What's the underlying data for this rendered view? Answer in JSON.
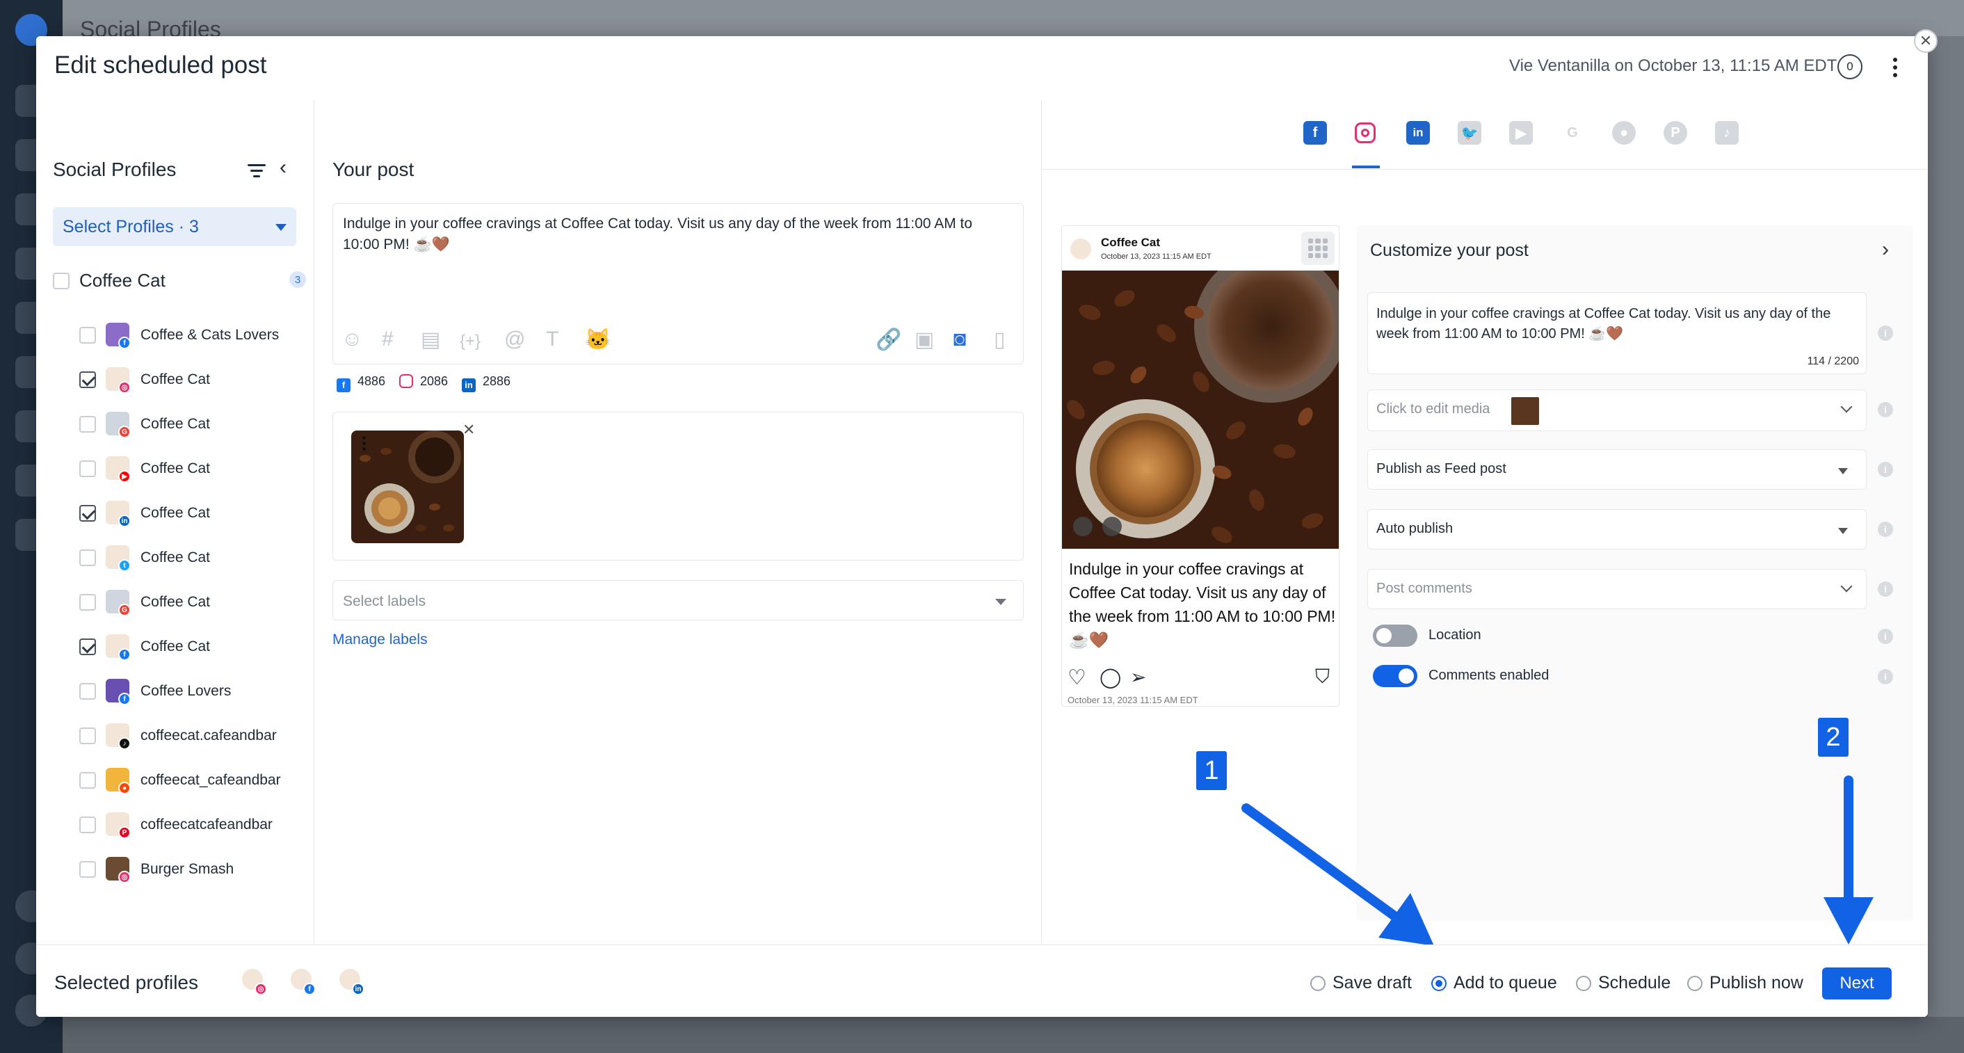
{
  "background": {
    "title": "Social Profiles"
  },
  "modal": {
    "title": "Edit scheduled post",
    "meta": "Vie Ventanilla on October 13, 11:15 AM EDT",
    "counter": "0"
  },
  "profiles": {
    "title": "Social Profiles",
    "select_label": "Select Profiles · 3",
    "group": {
      "label": "Coffee Cat",
      "count": "3"
    },
    "items": [
      {
        "label": "Coffee & Cats Lovers",
        "network": "facebook",
        "checked": false
      },
      {
        "label": "Coffee Cat",
        "network": "instagram",
        "checked": true
      },
      {
        "label": "Coffee Cat",
        "network": "google",
        "checked": false
      },
      {
        "label": "Coffee Cat",
        "network": "youtube",
        "checked": false
      },
      {
        "label": "Coffee Cat",
        "network": "linkedin",
        "checked": true
      },
      {
        "label": "Coffee Cat",
        "network": "twitter",
        "checked": false
      },
      {
        "label": "Coffee Cat",
        "network": "google",
        "checked": false
      },
      {
        "label": "Coffee Cat",
        "network": "facebook",
        "checked": true
      },
      {
        "label": "Coffee Lovers",
        "network": "facebook",
        "checked": false
      },
      {
        "label": "coffeecat.cafeandbar",
        "network": "tiktok",
        "checked": false
      },
      {
        "label": "coffeecat_cafeandbar",
        "network": "reddit",
        "checked": false
      },
      {
        "label": "coffeecatcafeandbar",
        "network": "pinterest",
        "checked": false
      },
      {
        "label": "Burger Smash",
        "network": "instagram",
        "checked": false
      }
    ]
  },
  "post": {
    "title": "Your post",
    "text": "Indulge in your coffee cravings at Coffee Cat today. Visit us any day of the week from 11:00 AM to 10:00 PM! ☕🤎",
    "counts": {
      "facebook": "4886",
      "instagram": "2086",
      "linkedin": "2886"
    },
    "labels_placeholder": "Select labels",
    "manage_labels": "Manage labels"
  },
  "preview": {
    "tabs": [
      "facebook",
      "instagram",
      "linkedin",
      "twitter",
      "youtube",
      "google",
      "reddit",
      "pinterest",
      "tiktok"
    ],
    "active_tab": "instagram",
    "card": {
      "name": "Coffee Cat",
      "date": "October 13, 2023 11:15 AM EDT",
      "caption": "Indulge in your coffee cravings at Coffee Cat today. Visit us any day of the week from 11:00 AM to 10:00 PM! ☕🤎",
      "time": "October 13, 2023 11:15 AM EDT"
    }
  },
  "customize": {
    "title": "Customize your post",
    "text": "Indulge in your coffee cravings at Coffee Cat today. Visit us any day of the week from 11:00 AM to 10:00 PM! ☕🤎",
    "char_count": "114 / 2200",
    "media_label": "Click to edit media",
    "publish_type": "Publish as Feed post",
    "publish_mode": "Auto publish",
    "comments_placeholder": "Post comments",
    "location_label": "Location",
    "location_on": false,
    "comments_label": "Comments enabled",
    "comments_on": true
  },
  "annotations": {
    "badge1": "1",
    "badge2": "2"
  },
  "footer": {
    "selected_label": "Selected profiles",
    "options": [
      {
        "label": "Save draft",
        "selected": false
      },
      {
        "label": "Add to queue",
        "selected": true
      },
      {
        "label": "Schedule",
        "selected": false
      },
      {
        "label": "Publish now",
        "selected": false
      }
    ],
    "next_label": "Next"
  },
  "colors": {
    "accent": "#1262e6",
    "facebook": "#1877f2",
    "instagram": "#e1306c",
    "linkedin": "#0a66c2",
    "toggle_on": "#1262e6",
    "toggle_off": "#9aa1aa"
  }
}
